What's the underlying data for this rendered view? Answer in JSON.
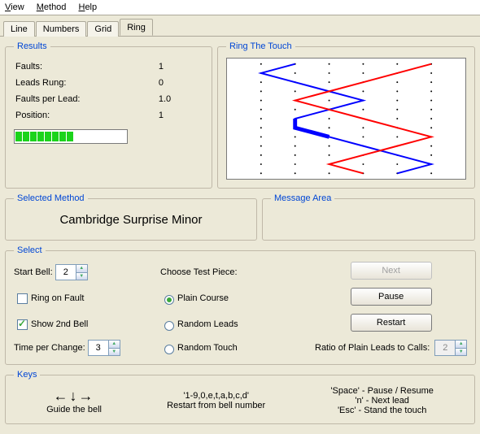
{
  "menu": {
    "view": "View",
    "method": "Method",
    "help": "Help"
  },
  "tabs": [
    "Line",
    "Numbers",
    "Grid",
    "Ring"
  ],
  "active_tab": "Ring",
  "results": {
    "legend": "Results",
    "rows": {
      "faults_label": "Faults:",
      "faults_value": "1",
      "leads_label": "Leads Rung:",
      "leads_value": "0",
      "fpl_label": "Faults per Lead:",
      "fpl_value": "1.0",
      "pos_label": "Position:",
      "pos_value": "1"
    },
    "progress_segments": 10,
    "progress_filled": 8
  },
  "ring_touch": {
    "legend": "Ring The Touch"
  },
  "chart_data": {
    "type": "line",
    "columns": 6,
    "rows": 13,
    "series": [
      {
        "name": "bell-blue",
        "color": "#0000ff",
        "x_by_row": [
          2,
          1,
          2,
          3,
          4,
          3,
          2,
          2,
          3,
          4,
          5,
          6,
          5
        ]
      },
      {
        "name": "bell-red",
        "color": "#ff0000",
        "x_by_row": [
          6,
          5,
          4,
          3,
          2,
          3,
          4,
          5,
          6,
          5,
          4,
          3,
          4
        ]
      }
    ],
    "emphasis": {
      "series": "bell-blue",
      "from_row": 6,
      "to_row": 8
    }
  },
  "selected_method": {
    "legend": "Selected Method",
    "name": "Cambridge Surprise Minor"
  },
  "message_area": {
    "legend": "Message Area"
  },
  "select": {
    "legend": "Select",
    "start_bell_label": "Start Bell:",
    "start_bell_value": "2",
    "ring_on_fault_label": "Ring on Fault",
    "ring_on_fault_checked": false,
    "show_2nd_label": "Show 2nd Bell",
    "show_2nd_checked": true,
    "time_per_change_label": "Time per Change:",
    "time_per_change_value": "3",
    "choose_label": "Choose Test Piece:",
    "opt_plain": "Plain Course",
    "opt_random_leads": "Random Leads",
    "opt_random_touch": "Random Touch",
    "selected_piece": "Plain Course",
    "btn_next": "Next",
    "btn_pause": "Pause",
    "btn_restart": "Restart",
    "ratio_label": "Ratio of Plain Leads to Calls:",
    "ratio_value": "2"
  },
  "keys": {
    "legend": "Keys",
    "guide_label": "Guide the bell",
    "restart_keys": "'1-9,0,e,t,a,b,c,d'",
    "restart_label": "Restart from bell number",
    "space_label": "'Space' - Pause / Resume",
    "n_label": "'n' - Next lead",
    "esc_label": "'Esc' - Stand the touch"
  }
}
